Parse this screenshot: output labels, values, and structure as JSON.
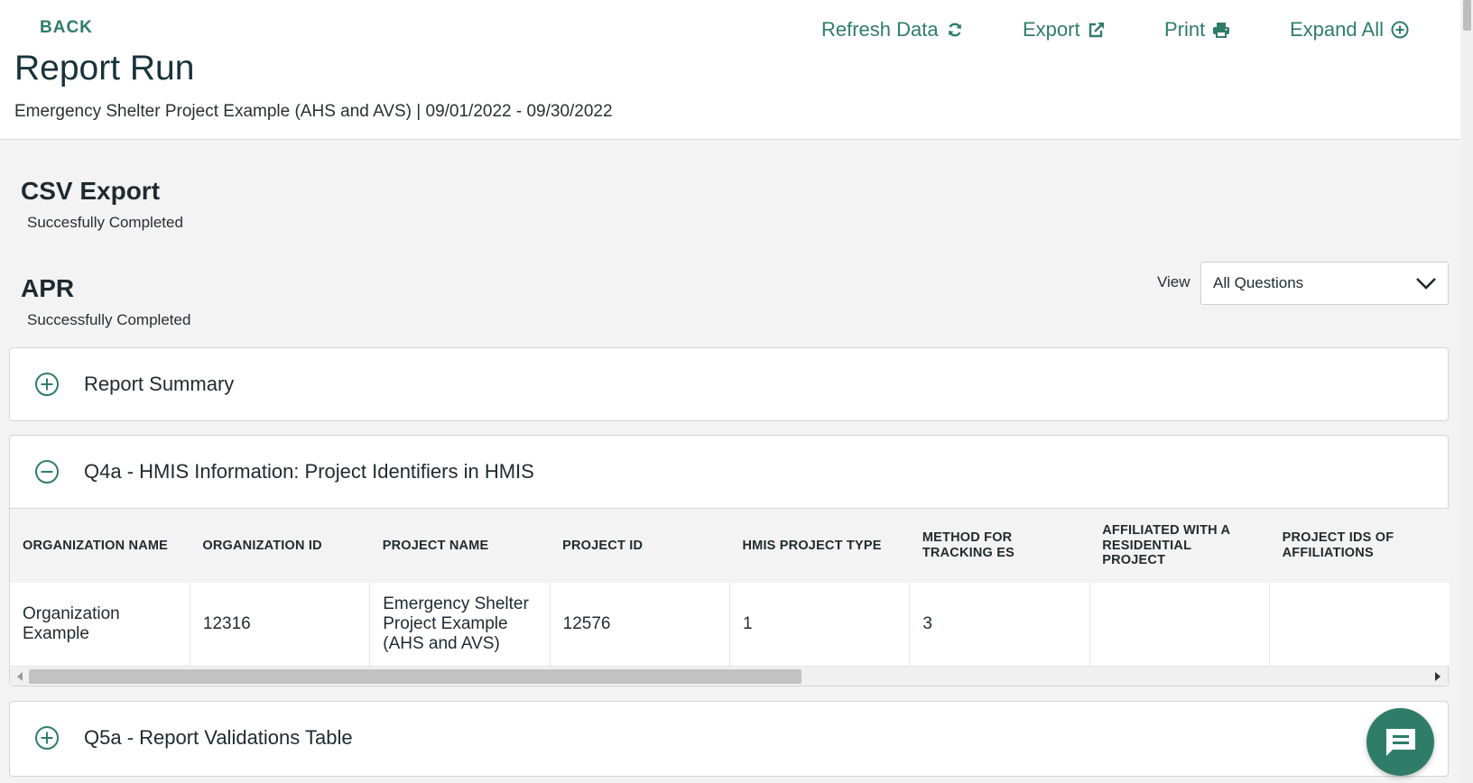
{
  "header": {
    "back_label": "BACK",
    "title": "Report Run",
    "subtitle": "Emergency Shelter Project Example (AHS and AVS) | 09/01/2022 - 09/30/2022"
  },
  "actions": {
    "refresh_label": "Refresh Data",
    "export_label": "Export",
    "print_label": "Print",
    "expand_label": "Expand All"
  },
  "csv_export": {
    "title": "CSV Export",
    "status": "Succesfully Completed"
  },
  "apr": {
    "title": "APR",
    "status": "Successfully Completed"
  },
  "view": {
    "label": "View",
    "selected": "All Questions"
  },
  "panels": {
    "report_summary": {
      "title": "Report Summary"
    },
    "q4a": {
      "title": "Q4a - HMIS Information: Project Identifiers in HMIS",
      "columns": [
        "ORGANIZATION NAME",
        "ORGANIZATION ID",
        "PROJECT NAME",
        "PROJECT ID",
        "HMIS PROJECT TYPE",
        "METHOD FOR TRACKING ES",
        "AFFILIATED WITH A RESIDENTIAL PROJECT",
        "PROJECT IDS OF AFFILIATIONS"
      ],
      "rows": [
        [
          "Organization Example",
          "12316",
          "Emergency Shelter Project Example (AHS and AVS)",
          "12576",
          "1",
          "3",
          "",
          ""
        ]
      ]
    },
    "q5a": {
      "title": "Q5a - Report Validations Table"
    }
  },
  "colors": {
    "accent": "#2f7d68",
    "background": "#f3f3f3",
    "text": "#1f2a30"
  },
  "icons": [
    "refresh-icon",
    "export-icon",
    "print-icon",
    "plus-circle-icon",
    "minus-circle-icon",
    "chevron-down-icon",
    "chat-icon"
  ]
}
